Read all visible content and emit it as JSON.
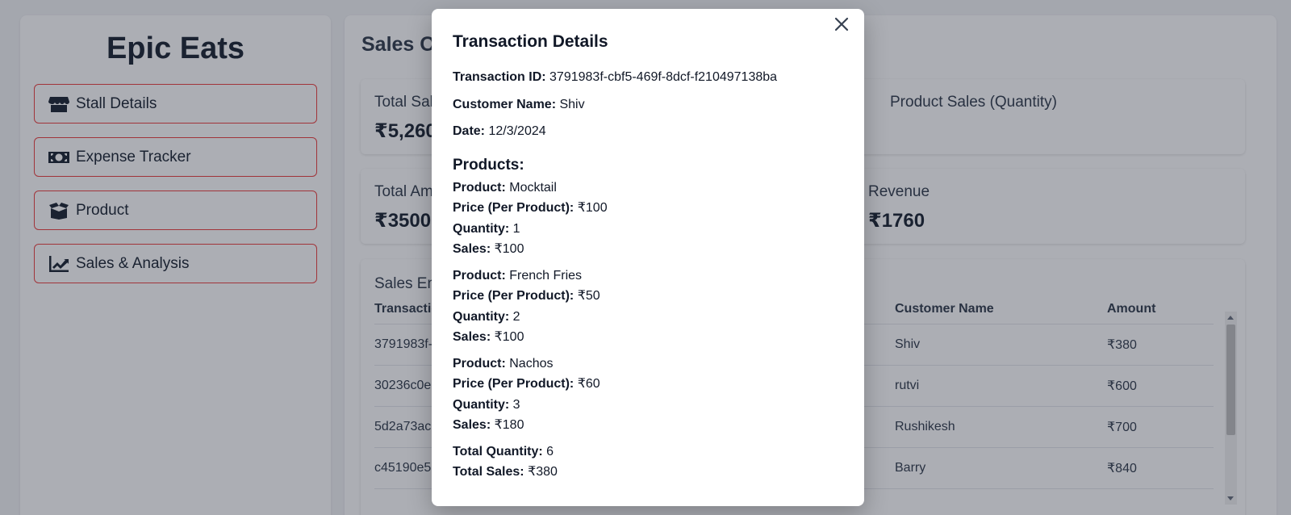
{
  "app": {
    "brand": "Epic Eats"
  },
  "sidebar": {
    "items": [
      {
        "label": "Stall Details",
        "icon": "store-icon"
      },
      {
        "label": "Expense Tracker",
        "icon": "money-icon"
      },
      {
        "label": "Product",
        "icon": "box-icon"
      },
      {
        "label": "Sales & Analysis",
        "icon": "chart-line-icon"
      }
    ]
  },
  "main": {
    "title": "Sales Overview",
    "cards": {
      "total_sales": {
        "label": "Total Sales",
        "value": "₹5,260"
      },
      "product_sales": {
        "label": "Product Sales (Quantity)"
      },
      "total_amount": {
        "label": "Total Amount",
        "value": "₹3500"
      },
      "revenue": {
        "label": "Revenue",
        "value": "₹1760"
      }
    },
    "table": {
      "label": "Sales Entries",
      "headers": {
        "id": "Transaction ID",
        "customer": "Customer Name",
        "amount": "Amount"
      },
      "rows": [
        {
          "id": "3791983f-cbf5-469f-8dcf-f210497138ba",
          "customer": "Shiv",
          "amount": "₹380"
        },
        {
          "id": "30236c0e",
          "customer": "rutvi",
          "amount": "₹600"
        },
        {
          "id": "5d2a73ac",
          "customer": "Rushikesh",
          "amount": "₹700"
        },
        {
          "id": "c45190e5",
          "customer": "Barry",
          "amount": "₹840"
        }
      ]
    }
  },
  "modal": {
    "title": "Transaction Details",
    "transaction_id_label": "Transaction ID:",
    "transaction_id": "3791983f-cbf5-469f-8dcf-f210497138ba",
    "customer_name_label": "Customer Name:",
    "customer_name": "Shiv",
    "date_label": "Date:",
    "date": "12/3/2024",
    "products_heading": "Products:",
    "labels": {
      "product": "Product:",
      "price": "Price (Per Product):",
      "quantity": "Quantity:",
      "sales": "Sales:"
    },
    "products": [
      {
        "name": "Mocktail",
        "price": "₹100",
        "quantity": "1",
        "sales": "₹100"
      },
      {
        "name": "French Fries",
        "price": "₹50",
        "quantity": "2",
        "sales": "₹100"
      },
      {
        "name": "Nachos",
        "price": "₹60",
        "quantity": "3",
        "sales": "₹180"
      }
    ],
    "total_quantity_label": "Total Quantity:",
    "total_quantity": "6",
    "total_sales_label": "Total Sales:",
    "total_sales": "₹380"
  },
  "colors": {
    "accent_border": "#ef4444",
    "overlay": "rgba(17,24,39,0.35)"
  }
}
